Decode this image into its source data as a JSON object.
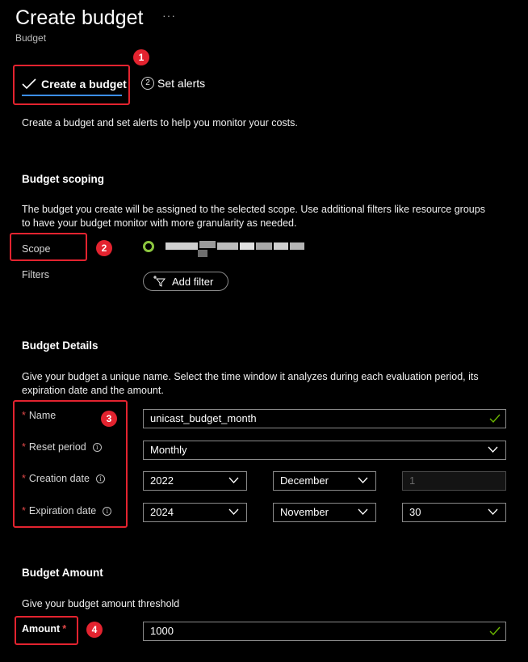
{
  "header": {
    "title": "Create budget",
    "more": "···",
    "subtitle": "Budget"
  },
  "wizard": {
    "steps": [
      {
        "label": "Create a budget",
        "status": "completed"
      },
      {
        "number": "2",
        "label": "Set alerts",
        "status": "pending"
      }
    ]
  },
  "intro": "Create a budget and set alerts to help you monitor your costs.",
  "scoping": {
    "title": "Budget scoping",
    "description_line1": "The budget you create will be assigned to the selected scope. Use additional filters like resource groups",
    "description_line2": "to have your budget monitor with more granularity as needed.",
    "scope_label": "Scope",
    "filters_label": "Filters",
    "add_filter_label": "Add filter"
  },
  "details": {
    "title": "Budget Details",
    "description_line1": "Give your budget a unique name. Select the time window it analyzes during each evaluation period, its",
    "description_line2": "expiration date and the amount.",
    "name_label": "Name",
    "name_value": "unicast_budget_month",
    "reset_label": "Reset period",
    "reset_value": "Monthly",
    "creation_label": "Creation date",
    "creation_year": "2022",
    "creation_month": "December",
    "creation_day": "1",
    "expiration_label": "Expiration date",
    "expiration_year": "2024",
    "expiration_month": "November",
    "expiration_day": "30"
  },
  "amount": {
    "title": "Budget Amount",
    "description": "Give your budget amount threshold",
    "label": "Amount",
    "value": "1000"
  },
  "annotations": [
    "1",
    "2",
    "3",
    "4"
  ],
  "colors": {
    "background": "#000000",
    "highlight": "#e3232f",
    "accent": "#3b8eea",
    "valid": "#6bb700",
    "scope_icon": "#8cc63f"
  }
}
